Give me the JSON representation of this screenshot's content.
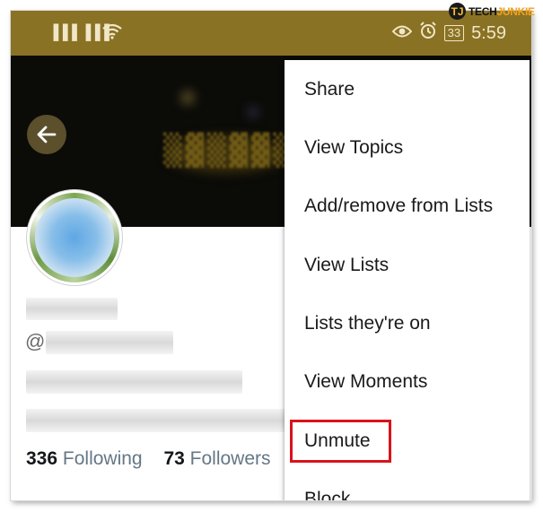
{
  "status_bar": {
    "signal_1": "▐▐▐",
    "signal_2": "▐▐▐",
    "battery": "33",
    "time": "5:59"
  },
  "watermark": {
    "brand_a": "TECH",
    "brand_b": "JUNKIE",
    "mark": "TJ"
  },
  "profile": {
    "handle_prefix": "@",
    "following_count": "336",
    "following_label": "Following",
    "followers_count": "73",
    "followers_label": "Followers"
  },
  "menu": {
    "items": [
      "Share",
      "View Topics",
      "Add/remove from Lists",
      "View Lists",
      "Lists they're on",
      "View Moments",
      "Unmute",
      "Block"
    ]
  },
  "colors": {
    "status_bar": "#8a7225",
    "highlight": "#d9131a",
    "menu_bg": "#ffffff"
  }
}
